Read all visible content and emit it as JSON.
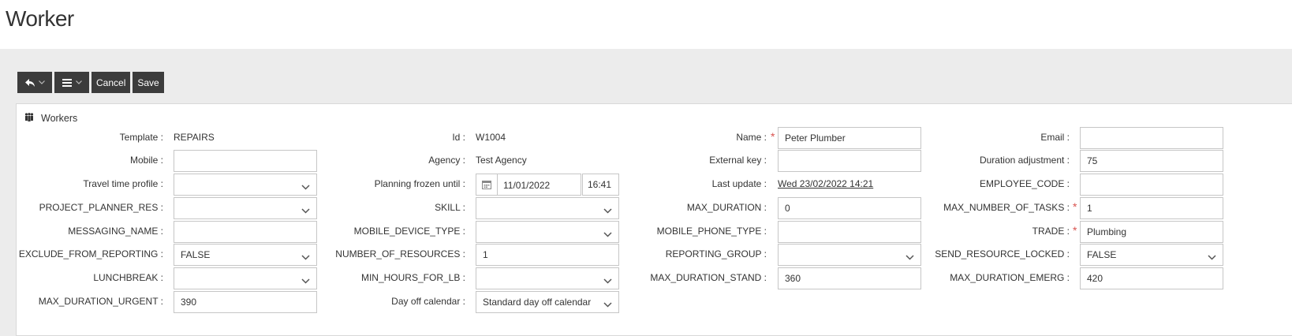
{
  "page": {
    "title": "Worker"
  },
  "toolbar": {
    "back_icon": "reply-arrow-icon",
    "menu_icon": "hamburger-menu-icon",
    "cancel_label": "Cancel",
    "save_label": "Save"
  },
  "panel": {
    "icon": "group-users-icon",
    "title": "Workers"
  },
  "fields": {
    "template": {
      "label": "Template :",
      "value": "REPAIRS"
    },
    "id": {
      "label": "Id :",
      "value": "W1004"
    },
    "name": {
      "label": "Name :",
      "value": "Peter Plumber",
      "required": true
    },
    "email": {
      "label": "Email :",
      "value": ""
    },
    "mobile": {
      "label": "Mobile :",
      "value": ""
    },
    "agency": {
      "label": "Agency :",
      "value": "Test Agency"
    },
    "external_key": {
      "label": "External key :",
      "value": ""
    },
    "duration_adjustment": {
      "label": "Duration adjustment :",
      "value": "75"
    },
    "travel_time_profile": {
      "label": "Travel time profile :",
      "value": ""
    },
    "planning_frozen_until": {
      "label": "Planning frozen until :",
      "date": "11/01/2022",
      "time": "16:41"
    },
    "last_update": {
      "label": "Last update :",
      "value": "Wed 23/02/2022 14:21"
    },
    "employee_code": {
      "label": "EMPLOYEE_CODE :",
      "value": ""
    },
    "project_planner_res": {
      "label": "PROJECT_PLANNER_RES :",
      "value": ""
    },
    "skill": {
      "label": "SKILL :",
      "value": ""
    },
    "max_duration": {
      "label": "MAX_DURATION :",
      "value": "0"
    },
    "max_number_of_tasks": {
      "label": "MAX_NUMBER_OF_TASKS :",
      "value": "1",
      "required": true
    },
    "messaging_name": {
      "label": "MESSAGING_NAME :",
      "value": ""
    },
    "mobile_device_type": {
      "label": "MOBILE_DEVICE_TYPE :",
      "value": ""
    },
    "mobile_phone_type": {
      "label": "MOBILE_PHONE_TYPE :",
      "value": ""
    },
    "trade": {
      "label": "TRADE :",
      "value": "Plumbing",
      "required": true
    },
    "exclude_from_reporting": {
      "label": "EXCLUDE_FROM_REPORTING :",
      "value": "FALSE"
    },
    "number_of_resources": {
      "label": "NUMBER_OF_RESOURCES :",
      "value": "1"
    },
    "reporting_group": {
      "label": "REPORTING_GROUP :",
      "value": ""
    },
    "send_resource_locked": {
      "label": "SEND_RESOURCE_LOCKED :",
      "value": "FALSE"
    },
    "lunchbreak": {
      "label": "LUNCHBREAK :",
      "value": ""
    },
    "min_hours_for_lb": {
      "label": "MIN_HOURS_FOR_LB :",
      "value": ""
    },
    "max_duration_stand": {
      "label": "MAX_DURATION_STAND :",
      "value": "360"
    },
    "max_duration_emerg": {
      "label": "MAX_DURATION_EMERG :",
      "value": "420"
    },
    "max_duration_urgent": {
      "label": "MAX_DURATION_URGENT :",
      "value": "390"
    },
    "day_off_calendar": {
      "label": "Day off calendar :",
      "value": "Standard day off calendar"
    }
  },
  "colors": {
    "toolbar_button": "#3c3c3c",
    "band": "#ececec",
    "required": "#d9534f"
  }
}
